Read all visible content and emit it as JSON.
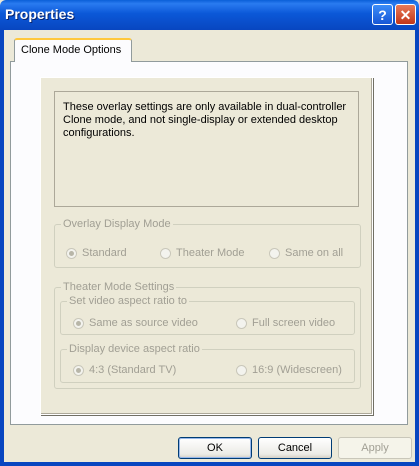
{
  "window": {
    "title": "Properties",
    "help_glyph": "?",
    "close_glyph": "✕"
  },
  "tabs": [
    {
      "label": "Clone Mode Options"
    }
  ],
  "info": {
    "text": "These overlay settings are only available in dual-controller Clone mode, and not single-display or extended desktop configurations."
  },
  "overlay_mode": {
    "legend": "Overlay Display Mode",
    "options": [
      {
        "label": "Standard",
        "selected": true
      },
      {
        "label": "Theater Mode",
        "selected": false
      },
      {
        "label": "Same on all",
        "selected": false
      }
    ]
  },
  "theater_settings": {
    "legend": "Theater Mode Settings",
    "video_aspect": {
      "legend": "Set video aspect ratio to",
      "options": [
        {
          "label": "Same as source video",
          "selected": true
        },
        {
          "label": "Full screen video",
          "selected": false
        }
      ]
    },
    "device_aspect": {
      "legend": "Display device aspect ratio",
      "options": [
        {
          "label": "4:3 (Standard TV)",
          "selected": true
        },
        {
          "label": "16:9 (Widescreen)",
          "selected": false
        }
      ]
    }
  },
  "buttons": {
    "ok": "OK",
    "cancel": "Cancel",
    "apply": "Apply"
  },
  "colors": {
    "titlebar": "#0846c0",
    "dialog_bg": "#ece9d8",
    "disabled_text": "#a19f94",
    "tab_highlight": "#ffc83c"
  }
}
